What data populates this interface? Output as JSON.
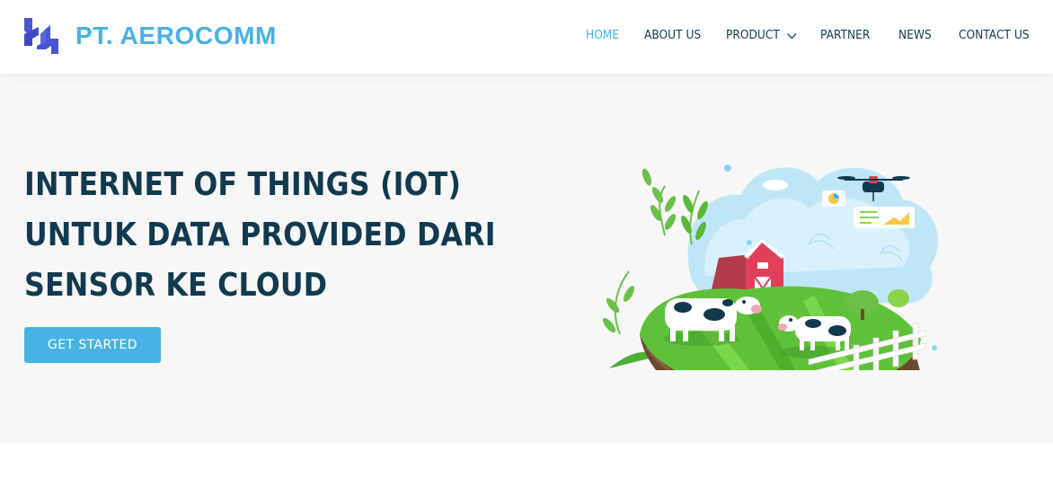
{
  "brand": {
    "name": "PT. AEROCOMM",
    "logo_icon": "aerocomm-logo-icon",
    "color": "#47b2e4"
  },
  "nav": {
    "items": [
      {
        "label": "HOME",
        "active": true
      },
      {
        "label": "ABOUT US",
        "active": false
      },
      {
        "label": "PRODUCT",
        "active": false,
        "has_dropdown": true,
        "icon": "chevron-down-icon"
      },
      {
        "label": "PARTNER",
        "active": false
      },
      {
        "label": "NEWS",
        "active": false
      },
      {
        "label": "CONTACT US",
        "active": false
      }
    ]
  },
  "hero": {
    "title_lines": [
      "INTERNET OF THINGS (IOT)",
      "UNTUK DATA PROVIDED DARI",
      "SENSOR KE CLOUD"
    ],
    "cta_label": "GET STARTED",
    "illustration": "smart-farm-iot-illustration"
  },
  "colors": {
    "accent": "#47b2e4",
    "text_dark": "#123a4e",
    "hero_bg": "#f7f7f7"
  }
}
